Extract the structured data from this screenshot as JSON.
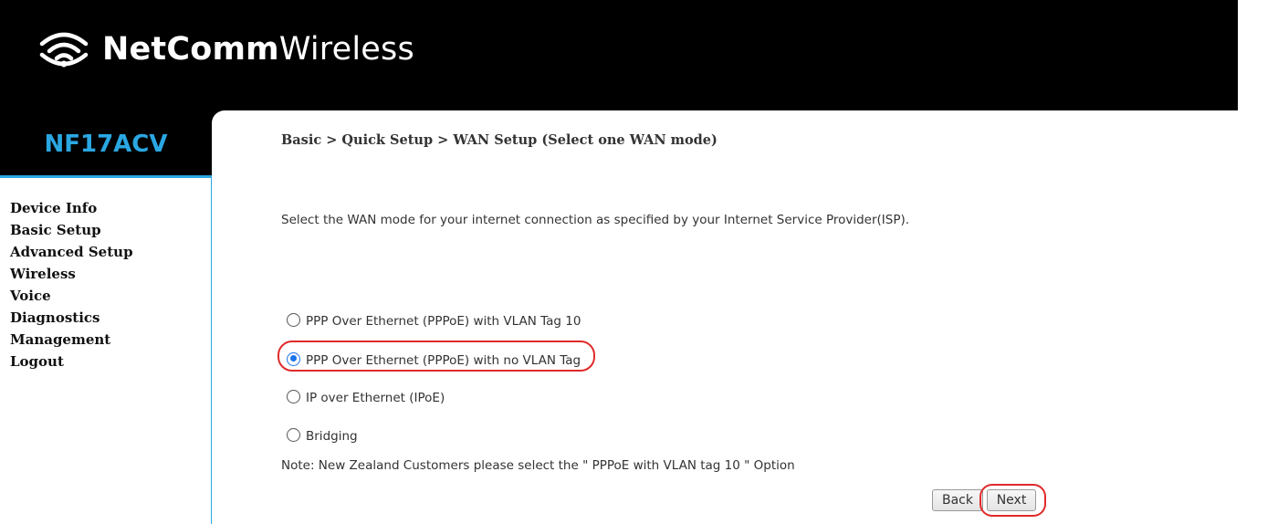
{
  "header": {
    "logo_bold": "NetComm",
    "logo_light": "Wireless",
    "logo_icon": "wifi-signal-icon"
  },
  "sidebar": {
    "model": "NF17ACV",
    "nav": [
      {
        "label": "Device Info"
      },
      {
        "label": "Basic Setup"
      },
      {
        "label": "Advanced Setup"
      },
      {
        "label": "Wireless"
      },
      {
        "label": "Voice"
      },
      {
        "label": "Diagnostics"
      },
      {
        "label": "Management"
      },
      {
        "label": "Logout"
      }
    ]
  },
  "main": {
    "breadcrumb": "Basic > Quick Setup > WAN Setup (Select one WAN mode)",
    "description": "Select the WAN mode for your internet connection as specified by your Internet Service Provider(ISP).",
    "options": [
      {
        "label": "PPP Over Ethernet (PPPoE) with VLAN Tag 10",
        "selected": false
      },
      {
        "label": "PPP Over Ethernet (PPPoE) with no VLAN Tag",
        "selected": true
      },
      {
        "label": "IP over Ethernet (IPoE)",
        "selected": false
      },
      {
        "label": "Bridging",
        "selected": false
      }
    ],
    "note": "Note: New Zealand Customers please select the \" PPPoE with VLAN tag 10 \" Option",
    "back_label": "Back",
    "next_label": "Next"
  },
  "colors": {
    "accent": "#2aa7e2",
    "highlight": "#e02a2a",
    "radio_selected": "#1a73e8"
  }
}
